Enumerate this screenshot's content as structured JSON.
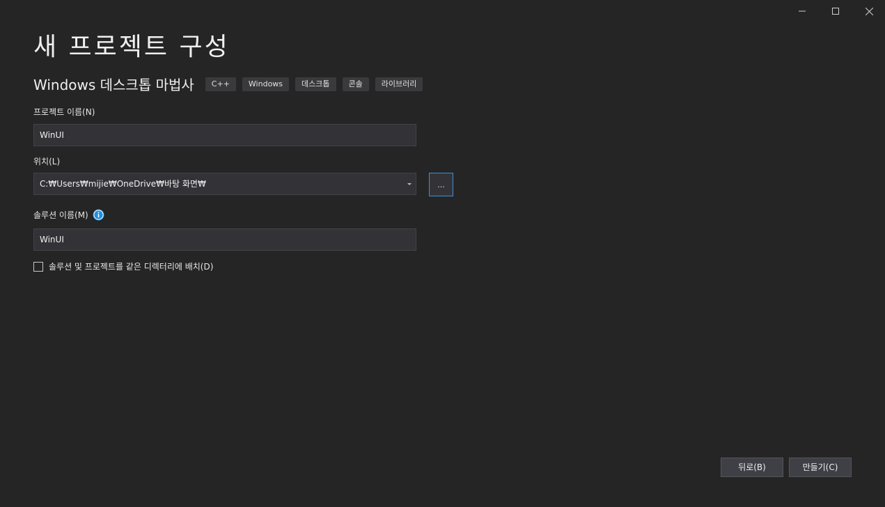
{
  "window": {
    "title": "새 프로젝트 구성"
  },
  "template": {
    "name": "Windows 데스크톱 마법사",
    "tags": [
      "C++",
      "Windows",
      "데스크톱",
      "콘솔",
      "라이브러리"
    ]
  },
  "project_name": {
    "label": "프로젝트 이름(N)",
    "value": "WinUI"
  },
  "location": {
    "label": "위치(L)",
    "value": "C:₩Users₩mijie₩OneDrive₩바탕 화면₩",
    "browse_label": "..."
  },
  "solution_name": {
    "label": "솔루션 이름(M)",
    "value": "WinUI",
    "info_icon": "info-icon"
  },
  "same_directory": {
    "label": "솔루션 및 프로젝트를 같은 디렉터리에 배치(D)",
    "checked": false
  },
  "footer": {
    "back_label": "뒤로(B)",
    "create_label": "만들기(C)"
  },
  "colors": {
    "background": "#252526",
    "input_bg": "#333337",
    "accent": "#3f8fd8",
    "info": "#1e90e0"
  }
}
